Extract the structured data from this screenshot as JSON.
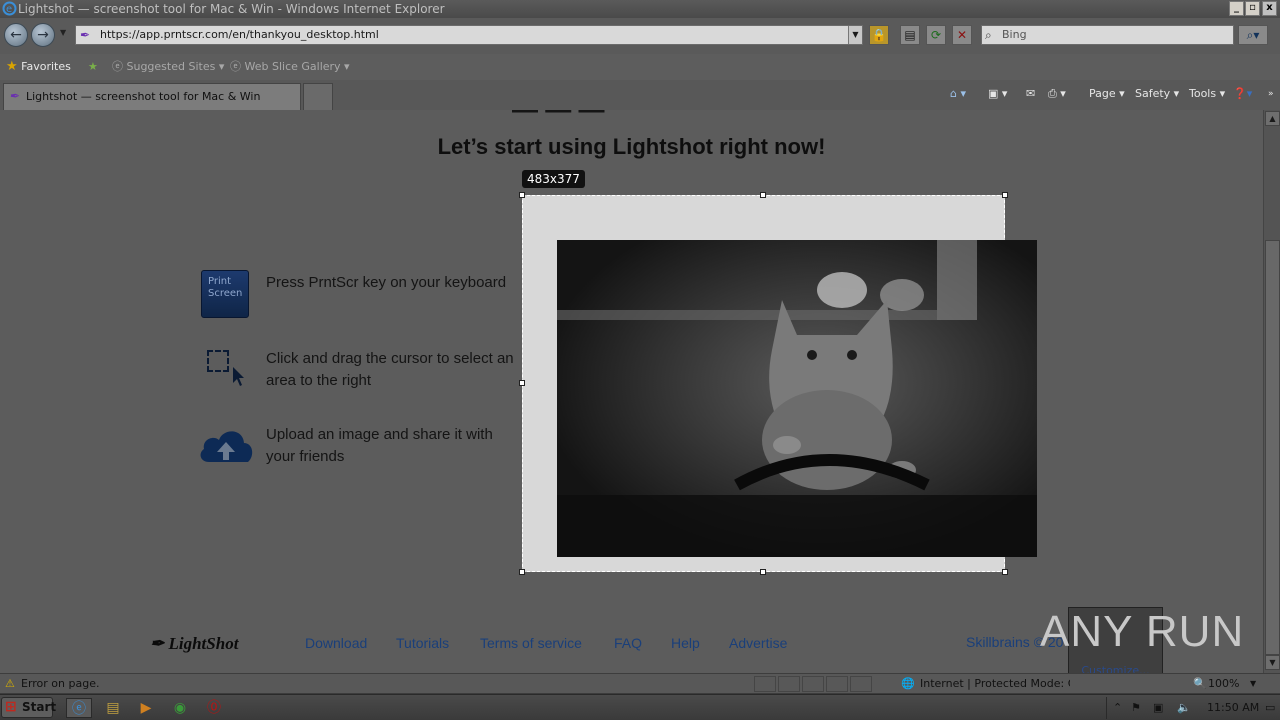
{
  "window": {
    "title": "Lightshot — screenshot tool for Mac & Win - Windows Internet Explorer"
  },
  "address": {
    "url": "https://app.prntscr.com/en/thankyou_desktop.html"
  },
  "search": {
    "placeholder": "Bing"
  },
  "favorites": {
    "label": "Favorites",
    "suggested": "Suggested Sites ▾",
    "webslice": "Web Slice Gallery ▾"
  },
  "tab": {
    "label": "Lightshot — screenshot tool for Mac & Win"
  },
  "commandbar": {
    "page": "Page ▾",
    "safety": "Safety ▾",
    "tools": "Tools ▾"
  },
  "page": {
    "heading": "Let’s start using Lightshot right now!",
    "steps": [
      {
        "text": "Press PrntScr key on your keyboard",
        "icon": "print-screen-key-icon"
      },
      {
        "text": "Click and drag the cursor to select an area to the right",
        "icon": "selection-cursor-icon"
      },
      {
        "text": "Upload an image and share it with your friends",
        "icon": "cloud-upload-icon"
      }
    ],
    "keycap": {
      "line1": "Print",
      "line2": "Screen"
    },
    "selection_size": "483x377"
  },
  "footer": {
    "logo": "LightShot",
    "links": [
      "Download",
      "Tutorials",
      "Terms of service",
      "FAQ",
      "Help",
      "Advertise"
    ],
    "copyright": "Skillbrains © 20"
  },
  "overlay": {
    "customize": "Customize..."
  },
  "watermark": {
    "text": "ANY RUN"
  },
  "status": {
    "text": "Error on page.",
    "zone": "Internet | Protected Mode: On",
    "zoom": "100%"
  },
  "taskbar": {
    "start": "Start",
    "clock": "11:50 AM"
  }
}
